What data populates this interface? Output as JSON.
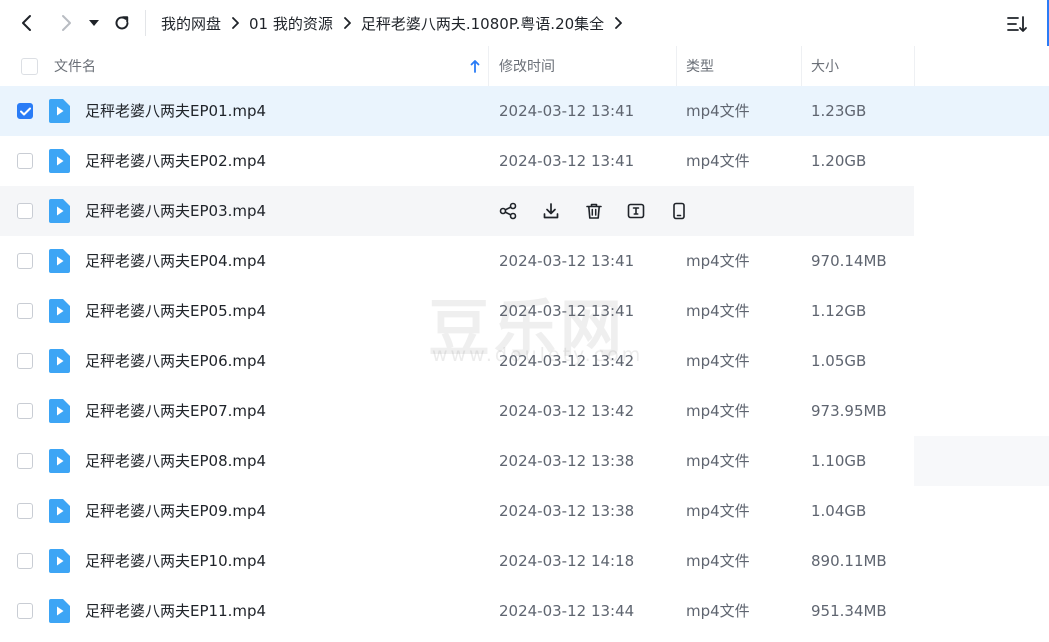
{
  "nav": {
    "breadcrumb": [
      "我的网盘",
      "01 我的资源",
      "足秤老婆八两夫.1080P.粤语.20集全"
    ]
  },
  "columns": {
    "name": "文件名",
    "modified": "修改时间",
    "type": "类型",
    "size": "大小"
  },
  "files": [
    {
      "name": "足秤老婆八两夫EP01.mp4",
      "modified": "2024-03-12 13:41",
      "type": "mp4文件",
      "size": "1.23GB",
      "checked": true
    },
    {
      "name": "足秤老婆八两夫EP02.mp4",
      "modified": "2024-03-12 13:41",
      "type": "mp4文件",
      "size": "1.20GB",
      "checked": false
    },
    {
      "name": "足秤老婆八两夫EP03.mp4",
      "modified": "",
      "type": "",
      "size": "",
      "checked": false,
      "hovered": true
    },
    {
      "name": "足秤老婆八两夫EP04.mp4",
      "modified": "2024-03-12 13:41",
      "type": "mp4文件",
      "size": "970.14MB",
      "checked": false
    },
    {
      "name": "足秤老婆八两夫EP05.mp4",
      "modified": "2024-03-12 13:41",
      "type": "mp4文件",
      "size": "1.12GB",
      "checked": false
    },
    {
      "name": "足秤老婆八两夫EP06.mp4",
      "modified": "2024-03-12 13:42",
      "type": "mp4文件",
      "size": "1.05GB",
      "checked": false
    },
    {
      "name": "足秤老婆八两夫EP07.mp4",
      "modified": "2024-03-12 13:42",
      "type": "mp4文件",
      "size": "973.95MB",
      "checked": false
    },
    {
      "name": "足秤老婆八两夫EP08.mp4",
      "modified": "2024-03-12 13:38",
      "type": "mp4文件",
      "size": "1.10GB",
      "checked": false
    },
    {
      "name": "足秤老婆八两夫EP09.mp4",
      "modified": "2024-03-12 13:38",
      "type": "mp4文件",
      "size": "1.04GB",
      "checked": false
    },
    {
      "name": "足秤老婆八两夫EP10.mp4",
      "modified": "2024-03-12 14:18",
      "type": "mp4文件",
      "size": "890.11MB",
      "checked": false
    },
    {
      "name": "足秤老婆八两夫EP11.mp4",
      "modified": "2024-03-12 13:44",
      "type": "mp4文件",
      "size": "951.34MB",
      "checked": false
    }
  ],
  "row_actions": [
    "share-icon",
    "download-icon",
    "delete-icon",
    "rename-icon",
    "mobile-icon"
  ],
  "watermark": {
    "main": "豆乐网",
    "sub": "www.doulety.com"
  },
  "colors": {
    "accent": "#2a7cf6",
    "selected_row": "#eaf4fd",
    "hover_row": "#f5f6f8",
    "file_icon": "#3da5f5"
  }
}
